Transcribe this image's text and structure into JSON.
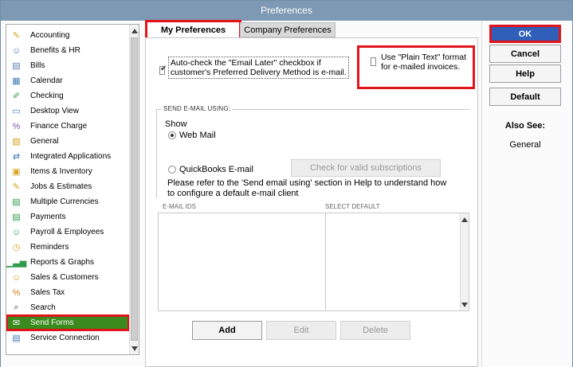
{
  "window": {
    "title": "Preferences"
  },
  "sidebar": {
    "items": [
      {
        "label": "Accounting",
        "icon": "accounting-icon",
        "glyph": "✎",
        "color": "#d6a21f"
      },
      {
        "label": "Benefits & HR",
        "icon": "benefits-icon",
        "glyph": "☺",
        "color": "#3f79b8"
      },
      {
        "label": "Bills",
        "icon": "bills-icon",
        "glyph": "▤",
        "color": "#5b7fae"
      },
      {
        "label": "Calendar",
        "icon": "calendar-icon",
        "glyph": "▦",
        "color": "#3f79b8"
      },
      {
        "label": "Checking",
        "icon": "checking-icon",
        "glyph": "✐",
        "color": "#2e9a4a"
      },
      {
        "label": "Desktop View",
        "icon": "desktop-icon",
        "glyph": "▭",
        "color": "#3f79b8"
      },
      {
        "label": "Finance Charge",
        "icon": "finance-charge-icon",
        "glyph": "%",
        "color": "#7d5aa6"
      },
      {
        "label": "General",
        "icon": "general-icon",
        "glyph": "▧",
        "color": "#d6a21f"
      },
      {
        "label": "Integrated Applications",
        "icon": "integrated-apps-icon",
        "glyph": "⇄",
        "color": "#3f79b8"
      },
      {
        "label": "Items & Inventory",
        "icon": "items-icon",
        "glyph": "▣",
        "color": "#d6a21f"
      },
      {
        "label": "Jobs & Estimates",
        "icon": "jobs-icon",
        "glyph": "✎",
        "color": "#d6a21f"
      },
      {
        "label": "Multiple Currencies",
        "icon": "currencies-icon",
        "glyph": "▤",
        "color": "#2e9a4a"
      },
      {
        "label": "Payments",
        "icon": "payments-icon",
        "glyph": "▤",
        "color": "#2e9a4a"
      },
      {
        "label": "Payroll & Employees",
        "icon": "payroll-icon",
        "glyph": "☺",
        "color": "#2e9a4a"
      },
      {
        "label": "Reminders",
        "icon": "reminders-icon",
        "glyph": "◷",
        "color": "#d6a21f"
      },
      {
        "label": "Reports & Graphs",
        "icon": "reports-icon",
        "glyph": "▁▃▅",
        "color": "#2e9a4a"
      },
      {
        "label": "Sales & Customers",
        "icon": "sales-customers-icon",
        "glyph": "☺",
        "color": "#d6a21f"
      },
      {
        "label": "Sales Tax",
        "icon": "sales-tax-icon",
        "glyph": "%",
        "color": "#d27a1f"
      },
      {
        "label": "Search",
        "icon": "search-icon",
        "glyph": "⌕",
        "color": "#333333"
      },
      {
        "label": "Send Forms",
        "icon": "send-forms-icon",
        "glyph": "✉",
        "color": "#ffffff"
      },
      {
        "label": "Service Connection",
        "icon": "service-connection-icon",
        "glyph": "▤",
        "color": "#3f79b8"
      }
    ]
  },
  "tabs": {
    "my": "My Preferences",
    "company": "Company Preferences"
  },
  "options": {
    "email_later": "Auto-check the \"Email Later\" checkbox if customer's Preferred Delivery Method is e-mail.",
    "email_later_checked": true,
    "plain_text": "Use \"Plain Text\" format for e-mailed invoices.",
    "plain_text_checked": false
  },
  "send_email": {
    "group_title": "SEND E-MAIL USING:",
    "show_label": "Show",
    "web_mail": "Web Mail",
    "qb_email": "QuickBooks E-mail",
    "check_button": "Check for valid subscriptions",
    "note": "Please refer to the 'Send email using' section in Help to understand how to configure a default e-mail client"
  },
  "table": {
    "col1": "E-MAIL IDS",
    "col2": "SELECT DEFAULT"
  },
  "footer": {
    "add": "Add",
    "edit": "Edit",
    "delete": "Delete"
  },
  "right": {
    "ok": "OK",
    "cancel": "Cancel",
    "help": "Help",
    "default": "Default",
    "also_see": "Also See:",
    "general": "General"
  },
  "colors": {
    "selected": "#3a8a1d",
    "highlight": "#e0141a",
    "ok": "#2f5fb8"
  }
}
